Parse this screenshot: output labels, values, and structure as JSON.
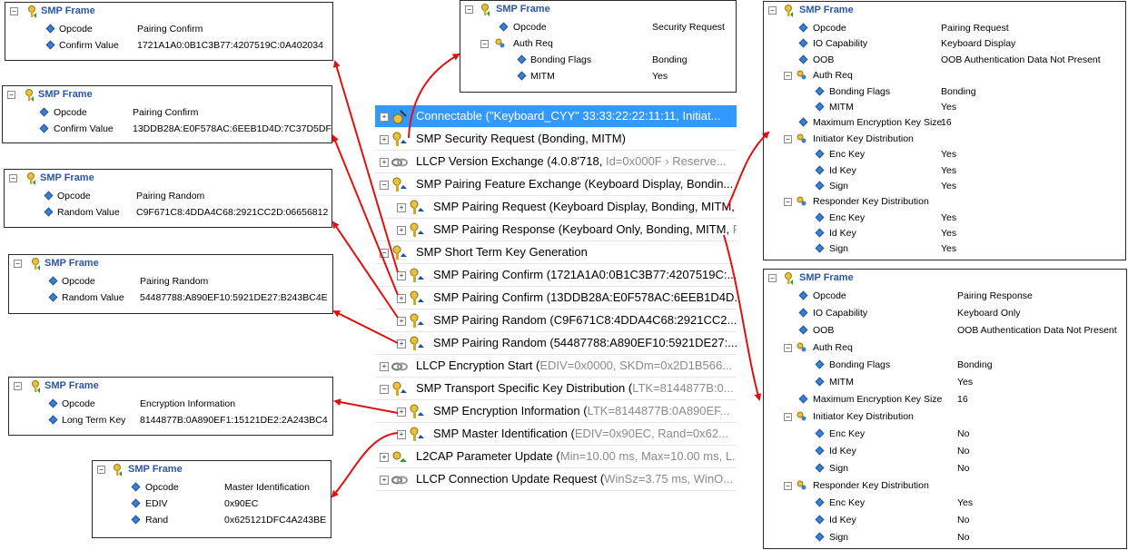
{
  "frame_title": "SMP Frame",
  "frames": {
    "f1": {
      "rows": [
        {
          "label": "Opcode",
          "value": "Pairing Confirm"
        },
        {
          "label": "Confirm Value",
          "value": "1721A1A0:0B1C3B77:4207519C:0A402034"
        }
      ]
    },
    "f2": {
      "rows": [
        {
          "label": "Opcode",
          "value": "Pairing Confirm"
        },
        {
          "label": "Confirm Value",
          "value": "13DDB28A:E0F578AC:6EEB1D4D:7C37D5DF"
        }
      ]
    },
    "f3": {
      "rows": [
        {
          "label": "Opcode",
          "value": "Pairing Random"
        },
        {
          "label": "Random Value",
          "value": "C9F671C8:4DDA4C68:2921CC2D:06656812"
        }
      ]
    },
    "f4": {
      "rows": [
        {
          "label": "Opcode",
          "value": "Pairing Random"
        },
        {
          "label": "Random Value",
          "value": "54487788:A890EF10:5921DE27:B243BC4E"
        }
      ]
    },
    "f5": {
      "rows": [
        {
          "label": "Opcode",
          "value": "Encryption Information"
        },
        {
          "label": "Long Term Key",
          "value": "8144877B:0A890EF1:15121DE2:2A243BC4"
        }
      ]
    },
    "f6": {
      "rows": [
        {
          "label": "Opcode",
          "value": "Master Identification"
        },
        {
          "label": "EDIV",
          "value": "0x90EC"
        },
        {
          "label": "Rand",
          "value": "0x625121DFC4A243BE"
        }
      ]
    },
    "ftop": {
      "rows": [
        {
          "label": "Opcode",
          "value": "Security Request"
        },
        {
          "label": "Auth Req",
          "value": ""
        },
        {
          "label": "Bonding Flags",
          "value": "Bonding"
        },
        {
          "label": "MITM",
          "value": "Yes"
        }
      ]
    },
    "fright1": {
      "rows": [
        {
          "label": "Opcode",
          "value": "Pairing Request"
        },
        {
          "label": "IO Capability",
          "value": "Keyboard Display"
        },
        {
          "label": "OOB",
          "value": "OOB Authentication Data Not Present"
        },
        {
          "label": "Auth Req",
          "value": ""
        },
        {
          "label": "Bonding Flags",
          "value": "Bonding"
        },
        {
          "label": "MITM",
          "value": "Yes"
        },
        {
          "label": "Maximum Encryption Key Size",
          "value": "16"
        },
        {
          "label": "Initiator Key Distribution",
          "value": ""
        },
        {
          "label": "Enc Key",
          "value": "Yes"
        },
        {
          "label": "Id Key",
          "value": "Yes"
        },
        {
          "label": "Sign",
          "value": "Yes"
        },
        {
          "label": "Responder Key Distribution",
          "value": ""
        },
        {
          "label": "Enc Key",
          "value": "Yes"
        },
        {
          "label": "Id Key",
          "value": "Yes"
        },
        {
          "label": "Sign",
          "value": "Yes"
        }
      ]
    },
    "fright2": {
      "rows": [
        {
          "label": "Opcode",
          "value": "Pairing Response"
        },
        {
          "label": "IO Capability",
          "value": "Keyboard Only"
        },
        {
          "label": "OOB",
          "value": "OOB Authentication Data Not Present"
        },
        {
          "label": "Auth Req",
          "value": ""
        },
        {
          "label": "Bonding Flags",
          "value": "Bonding"
        },
        {
          "label": "MITM",
          "value": "Yes"
        },
        {
          "label": "Maximum Encryption Key Size",
          "value": "16"
        },
        {
          "label": "Initiator Key Distribution",
          "value": ""
        },
        {
          "label": "Enc Key",
          "value": "No"
        },
        {
          "label": "Id Key",
          "value": "No"
        },
        {
          "label": "Sign",
          "value": "No"
        },
        {
          "label": "Responder Key Distribution",
          "value": ""
        },
        {
          "label": "Enc Key",
          "value": "Yes"
        },
        {
          "label": "Id Key",
          "value": "No"
        },
        {
          "label": "Sign",
          "value": "No"
        }
      ]
    }
  },
  "tree": [
    {
      "text": "Connectable (\"Keyboard_CYY\" 33:33:22:22:11:11, Initiat...",
      "gray": "",
      "icon": "connect-icon"
    },
    {
      "text": "SMP Security Request (Bonding, MITM)",
      "gray": "",
      "icon": "smp-icon"
    },
    {
      "text": "LLCP Version Exchange (4.0.8'718, ",
      "gray": "Id=0x000F › Reserve...",
      "icon": "llcp-icon"
    },
    {
      "text": "SMP Pairing Feature Exchange (Keyboard Display, Bondin...",
      "gray": "",
      "icon": "smp-icon"
    },
    {
      "text": "SMP Pairing Request (Keyboard Display, Bonding, MITM, ",
      "gray": "I",
      "icon": "smp-icon"
    },
    {
      "text": "SMP Pairing Response (Keyboard Only, Bonding, MITM, ",
      "gray": "R..",
      "icon": "smp-icon"
    },
    {
      "text": "SMP Short Term Key Generation",
      "gray": "",
      "icon": "smp-icon"
    },
    {
      "text": "SMP Pairing Confirm (1721A1A0:0B1C3B77:4207519C:...",
      "gray": "",
      "icon": "smp-icon"
    },
    {
      "text": "SMP Pairing Confirm (13DDB28A:E0F578AC:6EEB1D4D...",
      "gray": "",
      "icon": "smp-icon"
    },
    {
      "text": "SMP Pairing Random (C9F671C8:4DDA4C68:2921CC2...",
      "gray": "",
      "icon": "smp-icon"
    },
    {
      "text": "SMP Pairing Random (54487788:A890EF10:5921DE27:...",
      "gray": "",
      "icon": "smp-icon"
    },
    {
      "text": "LLCP Encryption Start (",
      "gray": "EDIV=0x0000, SKDm=0x2D1B566...",
      "icon": "llcp-icon"
    },
    {
      "text": "SMP Transport Specific Key Distribution (",
      "gray": "LTK=8144877B:0...",
      "icon": "smp-icon"
    },
    {
      "text": "SMP Encryption Information (",
      "gray": "LTK=8144877B:0A890EF...",
      "icon": "smp-icon"
    },
    {
      "text": "SMP Master Identification (",
      "gray": "EDIV=0x90EC, Rand=0x62...",
      "icon": "smp-icon"
    },
    {
      "text": "L2CAP Parameter Update (",
      "gray": "Min=10.00 ms, Max=10.00 ms, L..",
      "icon": "l2cap-icon"
    },
    {
      "text": "LLCP Connection Update Request (",
      "gray": "WinSz=3.75 ms, WinO...",
      "icon": "llcp-icon"
    }
  ]
}
